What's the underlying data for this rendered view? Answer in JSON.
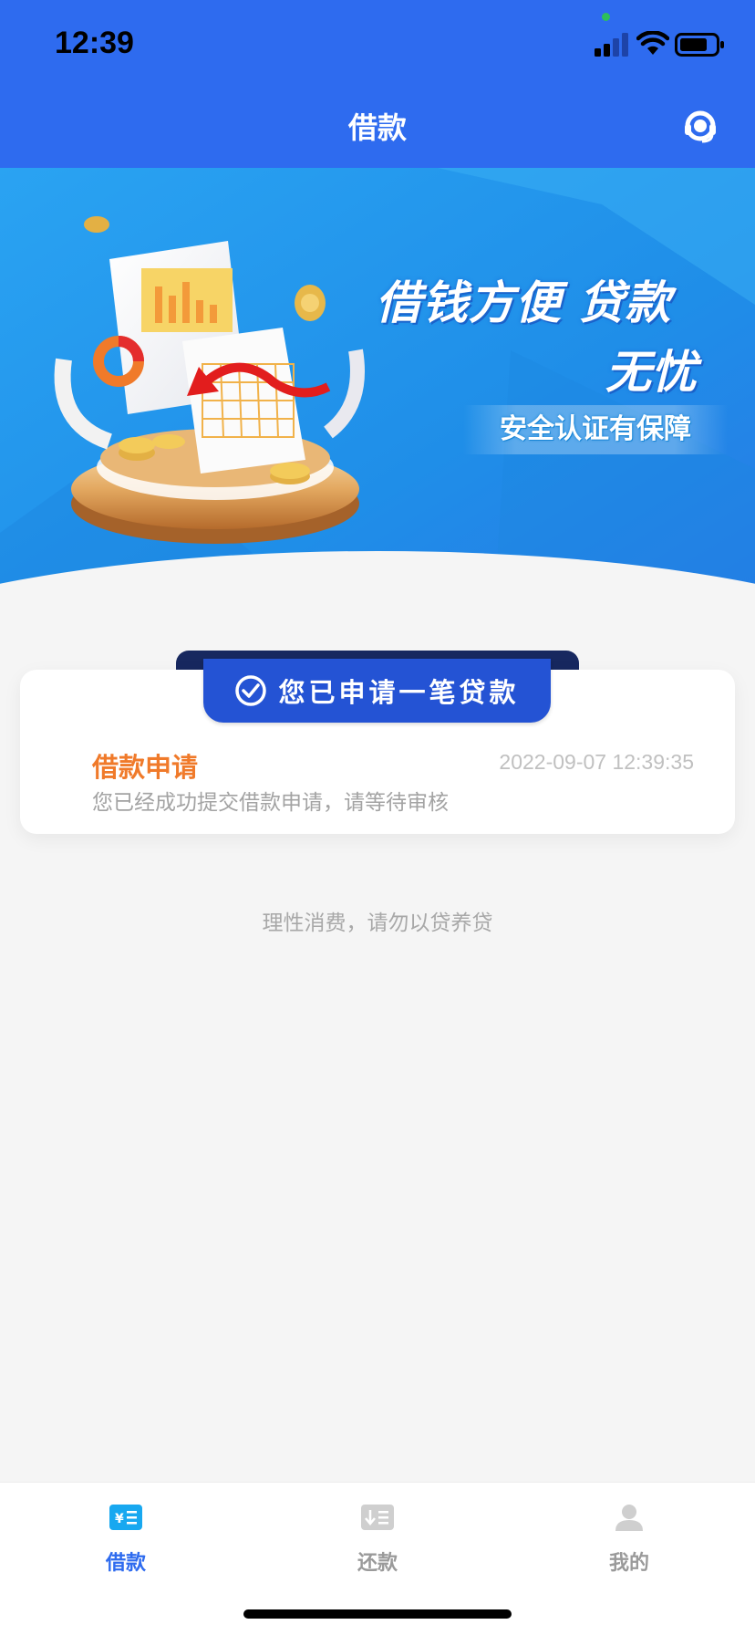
{
  "status_bar": {
    "time": "12:39"
  },
  "nav": {
    "title": "借款",
    "service_icon": "headset-icon"
  },
  "banner": {
    "headline": "借钱方便  贷款",
    "headline_cont": "无忧",
    "badge": "安全认证有保障"
  },
  "status_card": {
    "ribbon": "您已申请一笔贷款",
    "title": "借款申请",
    "timestamp": "2022-09-07 12:39:35",
    "description": "您已经成功提交借款申请，请等待审核"
  },
  "tip": "理性消费，请勿以贷养贷",
  "tabbar": {
    "items": [
      {
        "label": "借款",
        "icon": "loan-icon",
        "active": true
      },
      {
        "label": "还款",
        "icon": "repay-icon",
        "active": false
      },
      {
        "label": "我的",
        "icon": "profile-icon",
        "active": false
      }
    ]
  },
  "colors": {
    "primary": "#2e6bef",
    "accent_orange": "#f07a2a",
    "ribbon": "#2453d4"
  }
}
